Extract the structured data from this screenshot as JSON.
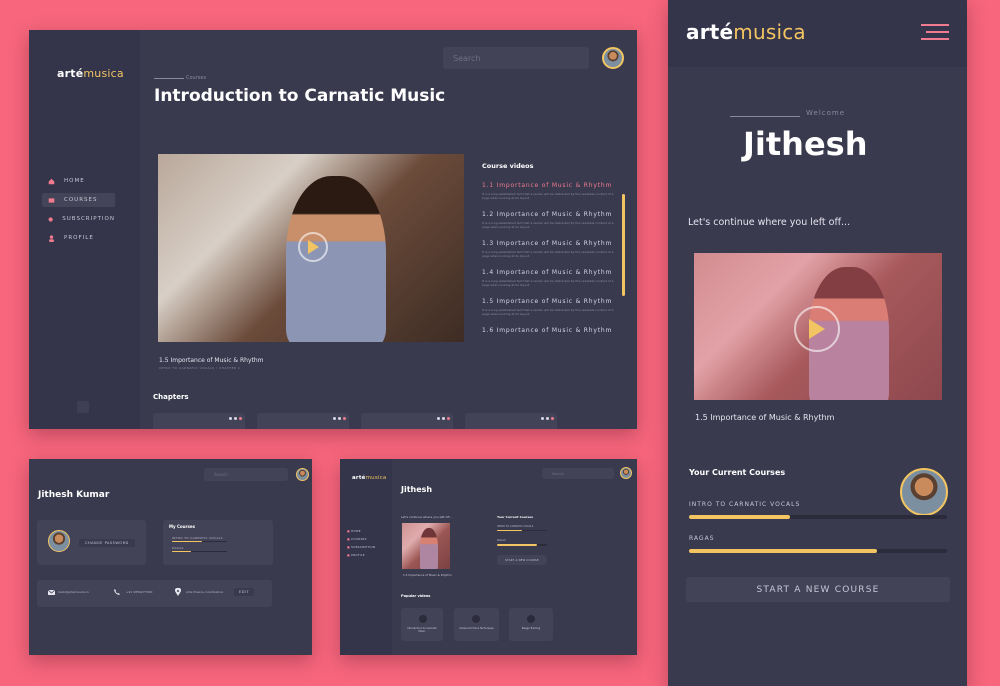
{
  "colors": {
    "background": "#f7667c",
    "panel": "#3a3a4f",
    "sidebar": "#34344a",
    "accent": "#f2c462",
    "active": "#f07b8f"
  },
  "brand": {
    "bold": "arté",
    "light": "musica"
  },
  "main": {
    "search_placeholder": "Search",
    "breadcrumb": "Courses",
    "title": "Introduction to Carnatic Music",
    "nav": [
      {
        "label": "HOME",
        "icon": "home-icon"
      },
      {
        "label": "COURSES",
        "icon": "courses-icon"
      },
      {
        "label": "SUBSCRIPTION",
        "icon": "subscription-icon"
      },
      {
        "label": "PROFILE",
        "icon": "profile-icon"
      }
    ],
    "video_caption": "1.5 Importance of Music & Rhythm",
    "video_sub": "INTRO TO CARNATIC VOCALS  /  CHAPTER 1",
    "chapters_heading": "Chapters",
    "course_videos_heading": "Course videos",
    "course_videos": [
      {
        "title": "1.1 Importance of Music & Rhythm",
        "desc": "It is a long established fact that a reader will be distracted by the readable content of a page when looking at its layout."
      },
      {
        "title": "1.2 Importance of Music & Rhythm",
        "desc": "It is a long established fact that a reader will be distracted by the readable content of a page when looking at its layout."
      },
      {
        "title": "1.3 Importance of Music & Rhythm",
        "desc": "It is a long established fact that a reader will be distracted by the readable content of a page when looking at its layout."
      },
      {
        "title": "1.4 Importance of Music & Rhythm",
        "desc": "It is a long established fact that a reader will be distracted by the readable content of a page when looking at its layout."
      },
      {
        "title": "1.5 Importance of Music & Rhythm",
        "desc": "It is a long established fact that a reader will be distracted by the readable content of a page when looking at its layout."
      },
      {
        "title": "1.6 Importance of Music & Rhythm",
        "desc": ""
      }
    ]
  },
  "profile": {
    "search_placeholder": "Search",
    "name": "Jithesh Kumar",
    "change_password": "CHANGE PASSWORD",
    "my_courses_heading": "My Courses",
    "courses": [
      {
        "label": "INTRO TO CARNATIC VOCALS",
        "progress": 0.55
      },
      {
        "label": "RAGAS",
        "progress": 0.35
      }
    ],
    "email": "hello@artemusica.in",
    "phone": "+91 9856277000",
    "location": "Arte Musica, Coimbatore",
    "edit": "EDIT"
  },
  "home": {
    "search_placeholder": "Search",
    "name": "Jithesh",
    "nav": [
      "HOME",
      "COURSES",
      "SUBSCRIPTION",
      "PROFILE"
    ],
    "continue": "Let's continue where you left off...",
    "video_caption": "1.5 Importance of Music & Rhythm",
    "current_courses": "Your Current Courses",
    "courses": [
      {
        "label": "INTRO TO CARNATIC VOCALS",
        "progress": 0.5
      },
      {
        "label": "RAGAS",
        "progress": 0.8
      }
    ],
    "start_new": "START A NEW COURSE",
    "popular": "Popular videos",
    "popular_videos": [
      "Introduction to Carnatic Music",
      "Advanced Voice Techniques",
      "Raaga Training"
    ]
  },
  "mobile": {
    "welcome": "Welcome",
    "name": "Jithesh",
    "continue": "Let's continue where you left off...",
    "video_caption": "1.5 Importance of Music & Rhythm",
    "current_courses": "Your Current Courses",
    "courses": [
      {
        "label": "INTRO TO CARNATIC VOCALS",
        "progress": 0.39
      },
      {
        "label": "RAGAS",
        "progress": 0.73
      }
    ],
    "start_new": "START A NEW COURSE"
  }
}
